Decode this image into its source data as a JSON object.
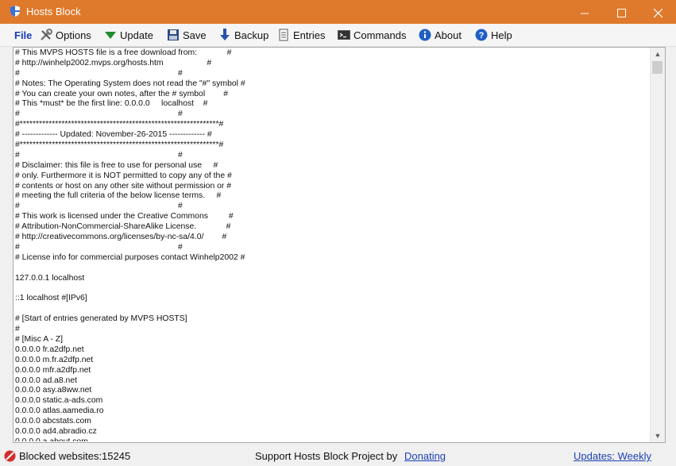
{
  "window": {
    "title": "Hosts Block"
  },
  "menu": {
    "file": "File",
    "options": "Options",
    "update": "Update",
    "save": "Save",
    "backup": "Backup",
    "entries": "Entries",
    "commands": "Commands",
    "about": "About",
    "help": "Help"
  },
  "editor": {
    "lines": [
      "# This MVPS HOSTS file is a free download from:             #",
      "# http://winhelp2002.mvps.org/hosts.htm                   #",
      "#                                                                     #",
      "# Notes: The Operating System does not read the \"#\" symbol #",
      "# You can create your own notes, after the # symbol        #",
      "# This *must* be the first line: 0.0.0.0     localhost    #",
      "#                                                                     #",
      "#**************************************************************#",
      "# ------------- Updated: November-26-2015 ------------- #",
      "#**************************************************************#",
      "#                                                                     #",
      "# Disclaimer: this file is free to use for personal use     #",
      "# only. Furthermore it is NOT permitted to copy any of the #",
      "# contents or host on any other site without permission or #",
      "# meeting the full criteria of the below license terms.     #",
      "#                                                                     #",
      "# This work is licensed under the Creative Commons         #",
      "# Attribution-NonCommercial-ShareAlike License.             #",
      "# http://creativecommons.org/licenses/by-nc-sa/4.0/        #",
      "#                                                                     #",
      "# License info for commercial purposes contact Winhelp2002 #",
      "",
      "127.0.0.1 localhost",
      "",
      "::1 localhost #[IPv6]",
      "",
      "# [Start of entries generated by MVPS HOSTS]",
      "#",
      "# [Misc A - Z]",
      "0.0.0.0 fr.a2dfp.net",
      "0.0.0.0 m.fr.a2dfp.net",
      "0.0.0.0 mfr.a2dfp.net",
      "0.0.0.0 ad.a8.net",
      "0.0.0.0 asy.a8ww.net",
      "0.0.0.0 static.a-ads.com",
      "0.0.0.0 atlas.aamedia.ro",
      "0.0.0.0 abcstats.com",
      "0.0.0.0 ad4.abradio.cz",
      "0.0.0.0 a.about.com"
    ]
  },
  "status": {
    "blocked": "Blocked websites:15245",
    "support_text": "Support Hosts Block Project by",
    "donating": "Donating",
    "updates": "Updates: Weekly"
  },
  "colors": {
    "titlebar": "#df7a2c",
    "link": "#1a3fb5"
  }
}
